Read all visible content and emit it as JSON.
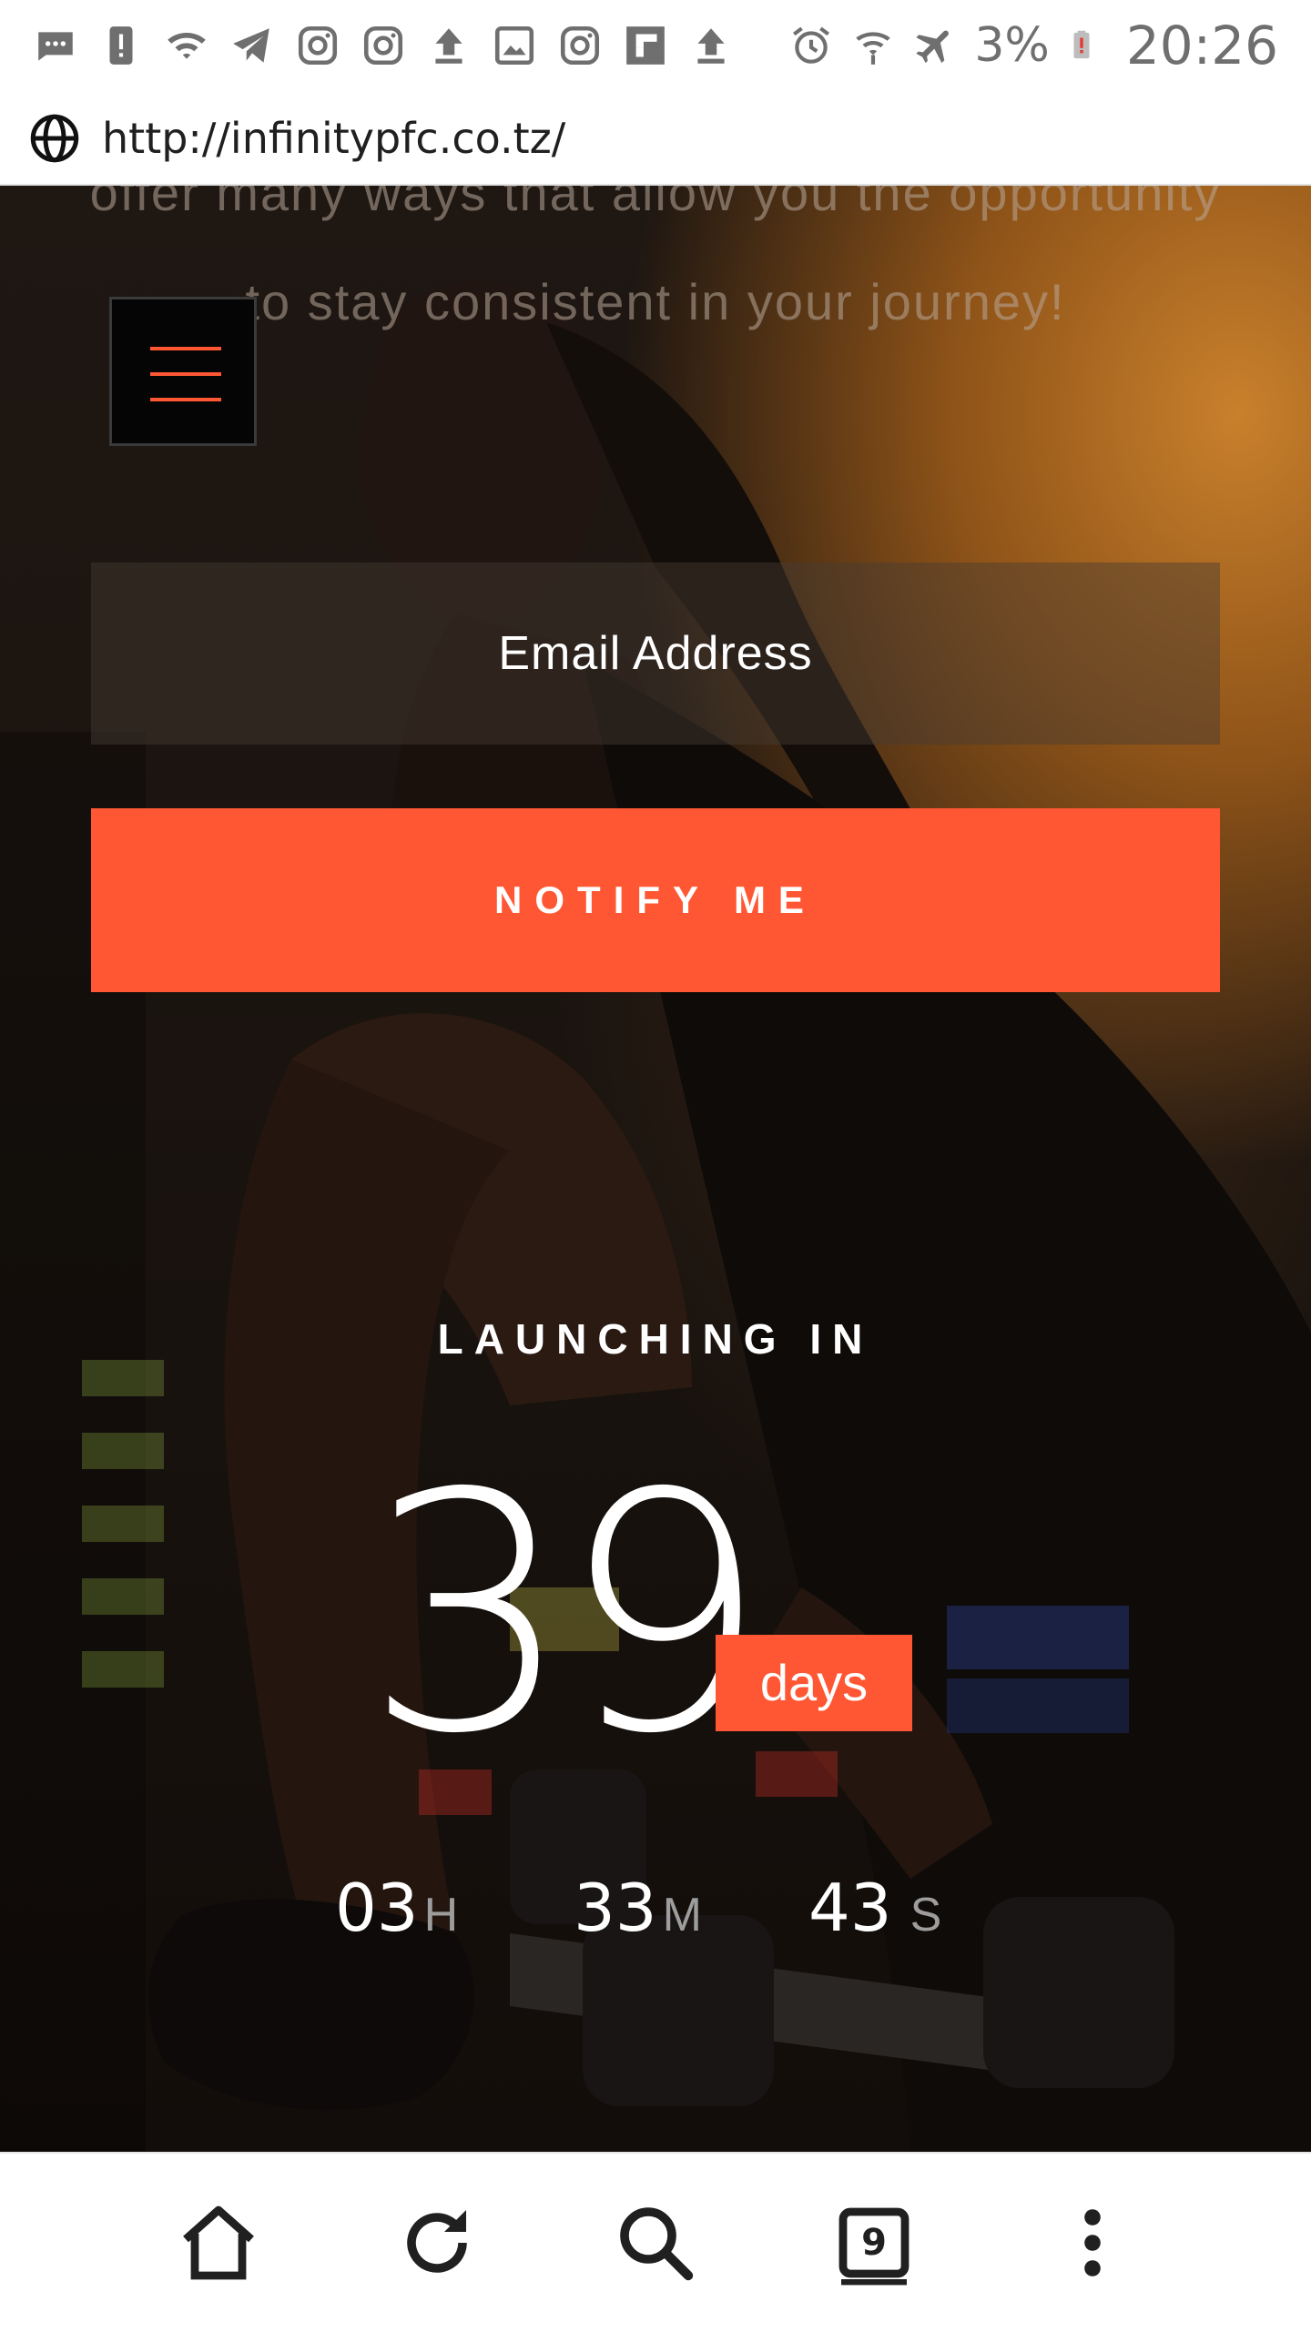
{
  "status_bar": {
    "battery_percent": "3%",
    "time": "20:26",
    "icons_left": [
      "sms-icon",
      "alert-icon",
      "wifi-icon",
      "telegram-icon",
      "instagram-icon",
      "instagram-icon",
      "upload-icon",
      "image-icon",
      "instagram-icon",
      "flipboard-icon",
      "upload-icon"
    ],
    "icons_right": [
      "alarm-icon",
      "wifi-calling-icon",
      "airplane-icon",
      "battery-low-icon"
    ]
  },
  "browser": {
    "url": "http://infinitypfc.co.tz/",
    "tab_count": "9"
  },
  "page": {
    "intro_text": "offer many ways that allow you the opportunity to stay consistent in your journey!",
    "email_placeholder": "Email Address",
    "notify_label": "NOTIFY ME",
    "launch_label": "LAUNCHING IN",
    "countdown": {
      "days": "39",
      "days_label": "days",
      "hours": "03",
      "hours_label": "H",
      "minutes": "33",
      "minutes_label": "M",
      "seconds": "43",
      "seconds_label": "S"
    }
  },
  "colors": {
    "accent": "#ff5733",
    "status_gray": "#6f6f6f"
  }
}
